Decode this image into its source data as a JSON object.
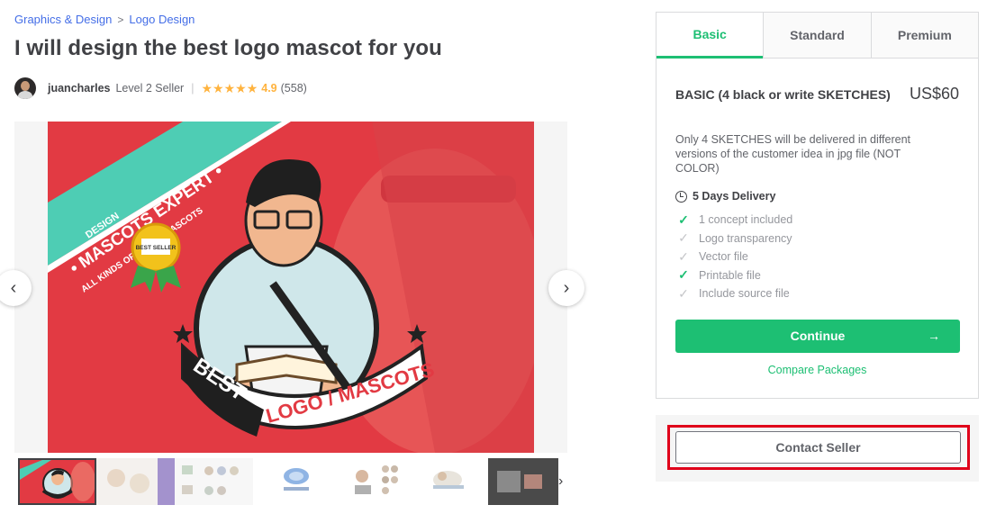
{
  "breadcrumb": {
    "category": "Graphics & Design",
    "separator": ">",
    "subcategory": "Logo Design"
  },
  "gig": {
    "title": "I will design the best logo mascot for you"
  },
  "seller": {
    "name": "juancharles",
    "level": "Level 2 Seller",
    "stars": "★★★★★",
    "rating": "4.9",
    "reviews": "(558)"
  },
  "gallery": {
    "prev_icon": "‹",
    "next_icon": "›",
    "thumb_next_icon": "›",
    "image_text": {
      "design": "DESIGN",
      "mascots_expert": "• MASCOTS EXPERT •",
      "all_kinds": "ALL KINDS OF LOGO / MASCOTS",
      "best_seller": "BEST SELLER",
      "best": "BEST",
      "logo_mascots": "LOGO / MASCOTS"
    }
  },
  "package": {
    "tabs": [
      "Basic",
      "Standard",
      "Premium"
    ],
    "active_tab": "Basic",
    "name": "BASIC (4 black or write SKETCHES)",
    "price": "US$60",
    "description": "Only 4 SKETCHES will be delivered in different versions of the customer idea in jpg file (NOT COLOR)",
    "delivery": "5 Days Delivery",
    "features": [
      {
        "label": "1 concept included",
        "included": true
      },
      {
        "label": "Logo transparency",
        "included": false
      },
      {
        "label": "Vector file",
        "included": false
      },
      {
        "label": "Printable file",
        "included": true
      },
      {
        "label": "Include source file",
        "included": false
      }
    ],
    "continue_label": "Continue",
    "continue_arrow": "→",
    "compare_label": "Compare Packages"
  },
  "contact": {
    "label": "Contact Seller"
  },
  "colors": {
    "accent": "#1dbf73",
    "highlight": "#e0001a",
    "star": "#ffb33e",
    "link": "#446ee7",
    "hero_bg": "#e23a43"
  }
}
